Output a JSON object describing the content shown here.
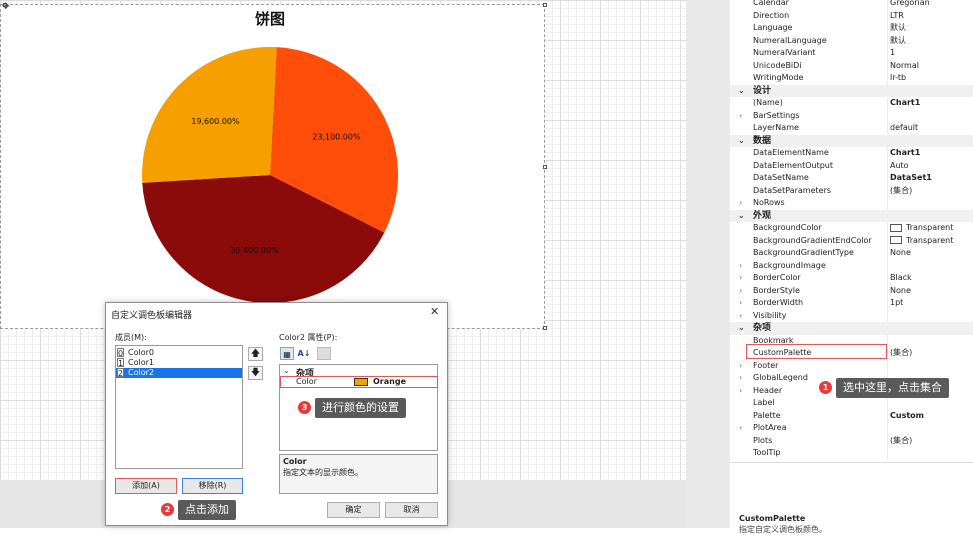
{
  "chart_data": {
    "type": "pie",
    "title": "饼图",
    "slices": [
      {
        "label": "23,100.00%",
        "value": 23100,
        "color": "#ff4d0a"
      },
      {
        "label": "30,400.00%",
        "value": 30400,
        "color": "#8b0a0a"
      },
      {
        "label": "19,600.00%",
        "value": 19600,
        "color": "#f5a000"
      }
    ]
  },
  "properties": {
    "rows": [
      {
        "type": "prop",
        "name": "Calendar",
        "value": "Gregorian"
      },
      {
        "type": "prop",
        "name": "Direction",
        "value": "LTR"
      },
      {
        "type": "prop",
        "name": "Language",
        "value": "默认"
      },
      {
        "type": "prop",
        "name": "NumeralLanguage",
        "value": "默认"
      },
      {
        "type": "prop",
        "name": "NumeralVariant",
        "value": "1"
      },
      {
        "type": "prop",
        "name": "UnicodeBiDi",
        "value": "Normal"
      },
      {
        "type": "prop",
        "name": "WritingMode",
        "value": "lr-tb"
      },
      {
        "type": "cat",
        "name": "设计"
      },
      {
        "type": "prop",
        "name": "(Name)",
        "value": "Chart1",
        "bold": true
      },
      {
        "type": "prop",
        "name": "BarSettings",
        "value": "",
        "expand": true
      },
      {
        "type": "prop",
        "name": "LayerName",
        "value": "default"
      },
      {
        "type": "cat",
        "name": "数据"
      },
      {
        "type": "prop",
        "name": "DataElementName",
        "value": "Chart1",
        "bold": true
      },
      {
        "type": "prop",
        "name": "DataElementOutput",
        "value": "Auto"
      },
      {
        "type": "prop",
        "name": "DataSetName",
        "value": "DataSet1",
        "bold": true
      },
      {
        "type": "prop",
        "name": "DataSetParameters",
        "value": "(集合)"
      },
      {
        "type": "prop",
        "name": "NoRows",
        "value": "",
        "expand": true
      },
      {
        "type": "cat",
        "name": "外观"
      },
      {
        "type": "prop",
        "name": "BackgroundColor",
        "value": "Transparent",
        "swatch": true
      },
      {
        "type": "prop",
        "name": "BackgroundGradientEndColor",
        "value": "Transparent",
        "swatch": true
      },
      {
        "type": "prop",
        "name": "BackgroundGradientType",
        "value": "None"
      },
      {
        "type": "prop",
        "name": "BackgroundImage",
        "value": "",
        "expand": true
      },
      {
        "type": "prop",
        "name": "BorderColor",
        "value": "Black",
        "expand": true
      },
      {
        "type": "prop",
        "name": "BorderStyle",
        "value": "None",
        "expand": true
      },
      {
        "type": "prop",
        "name": "BorderWidth",
        "value": "1pt",
        "expand": true
      },
      {
        "type": "prop",
        "name": "Visibility",
        "value": "",
        "expand": true
      },
      {
        "type": "cat",
        "name": "杂项"
      },
      {
        "type": "prop",
        "name": "Bookmark",
        "value": ""
      },
      {
        "type": "prop",
        "name": "CustomPalette",
        "value": "(集合)"
      },
      {
        "type": "prop",
        "name": "Footer",
        "value": "",
        "expand": true
      },
      {
        "type": "prop",
        "name": "GlobalLegend",
        "value": "",
        "expand": true
      },
      {
        "type": "prop",
        "name": "Header",
        "value": "",
        "expand": true
      },
      {
        "type": "prop",
        "name": "Label",
        "value": ""
      },
      {
        "type": "prop",
        "name": "Palette",
        "value": "Custom",
        "bold": true
      },
      {
        "type": "prop",
        "name": "PlotArea",
        "value": "",
        "expand": true
      },
      {
        "type": "prop",
        "name": "Plots",
        "value": "(集合)"
      },
      {
        "type": "prop",
        "name": "ToolTip",
        "value": ""
      }
    ],
    "description_title": "CustomPalette",
    "description_text": "指定自定义调色板颜色。"
  },
  "callouts": {
    "c1": {
      "num": "1",
      "text": "选中这里，点击集合"
    },
    "c2": {
      "num": "2",
      "text": "点击添加"
    },
    "c3": {
      "num": "3",
      "text": "进行颜色的设置"
    }
  },
  "dialog": {
    "title": "自定义调色板编辑器",
    "close": "✕",
    "members_label": "成员(M):",
    "members": [
      {
        "index": "0",
        "name": "Color0",
        "selected": false
      },
      {
        "index": "1",
        "name": "Color1",
        "selected": false
      },
      {
        "index": "2",
        "name": "Color2",
        "selected": true
      }
    ],
    "props_label": "Color2 属性(P):",
    "category": "杂项",
    "prop_name": "Color",
    "prop_value": "Orange",
    "prop_color": "#f5a000",
    "desc_title": "Color",
    "desc_text": "指定文本的显示颜色。",
    "add_label": "添加(A)",
    "remove_label": "移除(R)",
    "ok_label": "确定",
    "cancel_label": "取消"
  }
}
